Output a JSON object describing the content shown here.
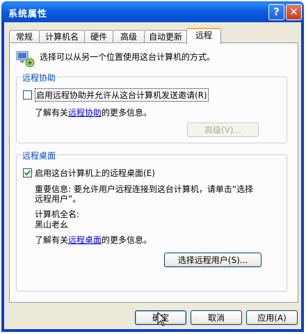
{
  "window": {
    "title": "系统属性",
    "help_label": "?",
    "close_label": "✕"
  },
  "tabs": [
    {
      "label": "常规"
    },
    {
      "label": "计算机名"
    },
    {
      "label": "硬件"
    },
    {
      "label": "高级"
    },
    {
      "label": "自动更新"
    },
    {
      "label": "远程"
    }
  ],
  "intro": {
    "text": "选择可以从另一个位置使用这台计算机的方式。",
    "icon": "remote-computer-icon"
  },
  "remote_assistance": {
    "group_title": "远程协助",
    "checkbox_label": "启用远程协助并允许从这台计算机发送邀请(R)",
    "checked": false,
    "learn_prefix": "了解有关",
    "learn_link": "远程协助",
    "learn_suffix": "的更多信息。",
    "advanced_button": "高级(V)..."
  },
  "remote_desktop": {
    "group_title": "远程桌面",
    "checkbox_label": "启用这台计算机上的远程桌面(E)",
    "checked": true,
    "important_line1": "重要信息: 要允许用户远程连接到这台计算机，请单击“选择",
    "important_line2": "远程用户”。",
    "full_name_label": "计算机全名:",
    "full_name_value": "黑山老幺",
    "learn_prefix": "了解有关",
    "learn_link": "远程桌面",
    "learn_suffix": "的更多信息。",
    "select_users_button": "选择远程用户(S)..."
  },
  "footer": {
    "ok": "确定",
    "cancel": "取消",
    "apply": "应用(A)"
  },
  "colors": {
    "titlebar": "#0b5fe0",
    "dialog_bg": "#ece9d8",
    "group_title": "#0046d5",
    "link": "#0000ee"
  }
}
